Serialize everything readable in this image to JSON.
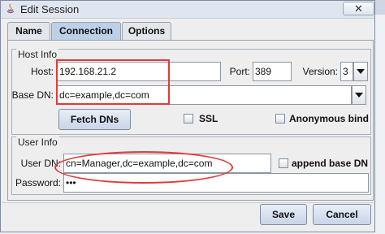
{
  "window": {
    "title": "Edit Session"
  },
  "tabs": [
    {
      "label": "Name",
      "active": false
    },
    {
      "label": "Connection",
      "active": true
    },
    {
      "label": "Options",
      "active": false
    }
  ],
  "host_info": {
    "title": "Host Info",
    "host_label": "Host:",
    "host_value": "192.168.21.2",
    "port_label": "Port:",
    "port_value": "389",
    "version_label": "Version:",
    "version_value": "3",
    "base_dn_label": "Base DN:",
    "base_dn_value": "dc=example,dc=com",
    "fetch_dns_label": "Fetch DNs",
    "ssl_label": "SSL",
    "ssl_checked": false,
    "anon_bind_label": "Anonymous bind",
    "anon_bind_checked": false
  },
  "user_info": {
    "title": "User Info",
    "user_dn_label": "User DN:",
    "user_dn_value": "cn=Manager,dc=example,dc=com",
    "append_base_dn_label": "append base DN",
    "append_base_dn_checked": false,
    "password_label": "Password:",
    "password_value": "•••"
  },
  "actions": {
    "save_label": "Save",
    "cancel_label": "Cancel"
  },
  "close_glyph": "✕",
  "colors": {
    "annotation": "#e23a3a",
    "active_tab": "#bcd0e7"
  }
}
